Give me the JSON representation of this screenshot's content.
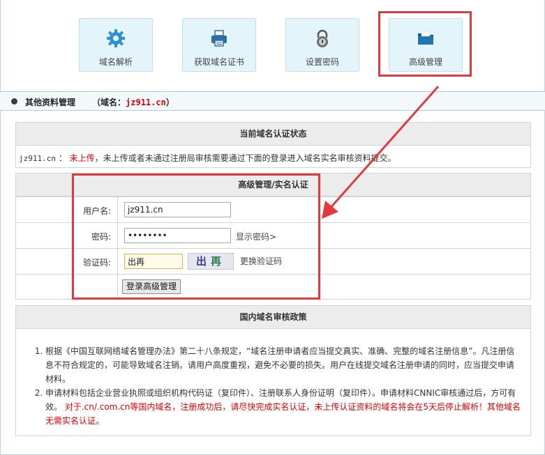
{
  "toolbar": {
    "items": [
      {
        "label": "域名解析",
        "icon": "gear-icon"
      },
      {
        "label": "获取域名证书",
        "icon": "printer-icon"
      },
      {
        "label": "设置密码",
        "icon": "lock-icon"
      },
      {
        "label": "高级管理",
        "icon": "folder-icon"
      }
    ]
  },
  "section": {
    "title": "其他资料管理",
    "domain_prefix": "（域名：",
    "domain": "jz911.cn",
    "domain_suffix": "）"
  },
  "status": {
    "header": "当前域名认证状态",
    "domain": "jz911.cn",
    "colon": "：",
    "state": "未上传",
    "message": "，未上传或者未通过注册局审核需要通过下面的登录进入域名实名审核资料提交。"
  },
  "login": {
    "header": "高级管理/实名认证",
    "username_label": "用户名:",
    "username_value": "jz911.cn",
    "password_label": "密码:",
    "password_value": "12345678",
    "show_password": "显示密码>",
    "captcha_label": "验证码:",
    "captcha_value": "出再",
    "captcha_chars": [
      "出",
      "再"
    ],
    "refresh_captcha": "更换验证码",
    "submit": "登录高级管理"
  },
  "policy": {
    "header": "国内域名审核政策",
    "items": [
      "根据《中国互联网络域名管理办法》第二十八条规定，“域名注册申请者应当提交真实、准确、完整的域名注册信息”。凡注册信息不符合规定的，可能导致域名注销。请用户高度重视，避免不必要的损失。用户在线提交域名注册申请的同时，应当提交申请材料。",
      "申请材料包括企业营业执照或组织机构代码证（复印件）、注册联系人身份证明（复印件）。申请材料CNNIC审核通过后，方可有效。"
    ],
    "warning": "对于.cn/.com.cn等国内域名，注册成功后，请尽快完成实名认证，未上传认证资料的域名将会在5天后停止解析！其他域名无需实名认证。"
  },
  "colors": {
    "highlight": "#e03a3e",
    "tool_bg": "#e4f4fb",
    "red_text": "#dd0000"
  }
}
